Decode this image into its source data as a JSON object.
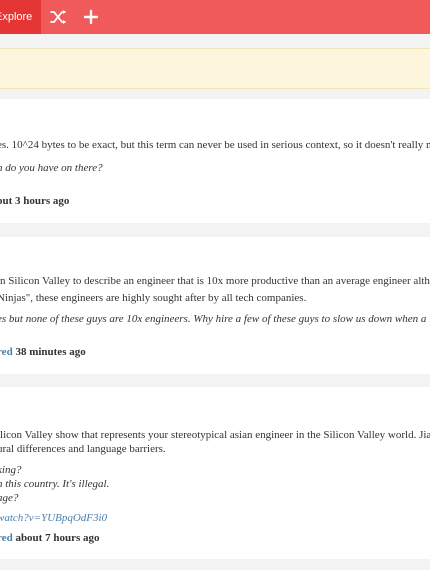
{
  "nav": {
    "explore_label": "Explore",
    "shuffle_icon": "shuffle-icon",
    "add_icon": "plus-icon"
  },
  "posts": [
    {
      "definition": "es. 10^24 bytes to be exact, but this term can never be used in serious context, so it doesn't really m",
      "example": "n do you have on there?",
      "meta_time": "out 3 hours ago"
    },
    {
      "header": ":",
      "definition_1": "in Silicon Valley to describe an engineer that is 10x more productive than an average engineer alth",
      "definition_2": "Ninjas\", these engineers are highly sought after by all tech companies.",
      "example": "es but none of these guys are 10x engineers. Why hire a few of these guys to slow us down when a 10x",
      "meta_link": "red",
      "meta_time": "38 minutes ago"
    },
    {
      "definition_1": "ilicon Valley show that represents your stereotypical asian engineer in the Silicon Valley world. Jian",
      "definition_2": "ural differences and language barriers.",
      "example_1": "king?",
      "example_2": "n this country. It's illegal.",
      "example_3": "age?",
      "video_link": "watch?v=YUBpqOdF3i0",
      "meta_link": "red",
      "meta_time": "about 7 hours ago"
    }
  ],
  "colors": {
    "nav_bg": "#f05a5a",
    "active_tab": "#e53535",
    "banner_bg": "#fdf6dc",
    "link": "#4a7fb0"
  }
}
